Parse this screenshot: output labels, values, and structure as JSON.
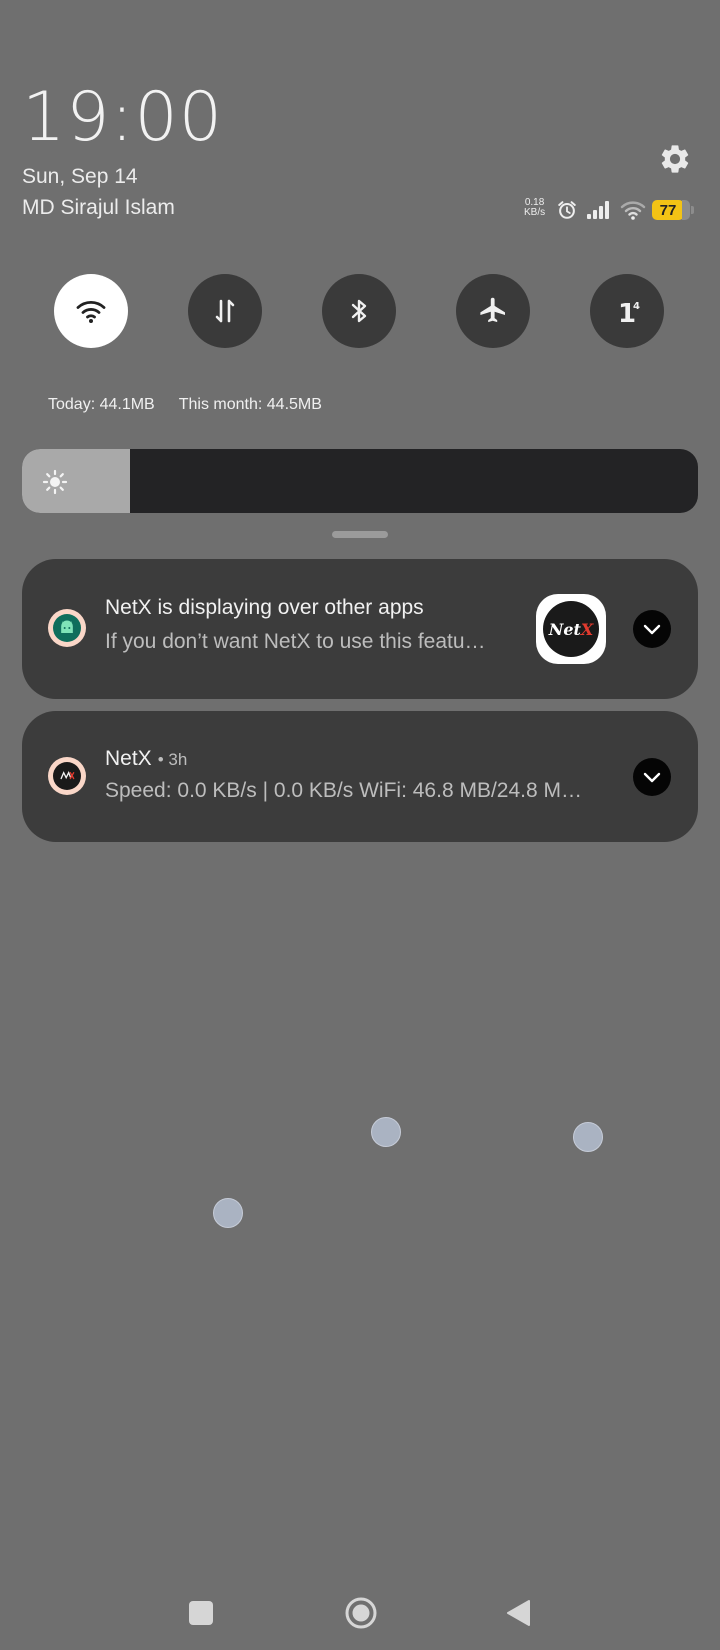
{
  "header": {
    "time": "19:00",
    "date": "Sun, Sep 14",
    "owner": "MD Sirajul Islam",
    "settings_icon": "gear-icon"
  },
  "status_bar": {
    "net_speed_value": "0.18",
    "net_speed_unit": "KB/s",
    "battery_level": "77",
    "battery_color": "#f3c315"
  },
  "quick_settings": [
    {
      "name": "wifi",
      "icon": "wifi-icon",
      "active": true
    },
    {
      "name": "mobile-data",
      "icon": "data-transfer-icon",
      "active": false
    },
    {
      "name": "bluetooth",
      "icon": "bluetooth-icon",
      "active": false
    },
    {
      "name": "airplane-mode",
      "icon": "airplane-icon",
      "active": false
    },
    {
      "name": "sim",
      "icon": "sim-1-icon",
      "active": false
    }
  ],
  "data_usage": {
    "today": "Today: 44.1MB",
    "month": "This month: 44.5MB"
  },
  "brightness": {
    "level": 0.16
  },
  "notifications": [
    {
      "title": "NetX is displaying over other apps",
      "text": "If you don’t want NetX to use this featu…"
    },
    {
      "title": "NetX",
      "meta": "• 3h",
      "text": "Speed: 0.0 KB/s | 0.0 KB/s WiFi: 46.8 MB/24.8 M…"
    }
  ],
  "thumbnail_logo": {
    "part1": "Net",
    "part2": "X"
  }
}
